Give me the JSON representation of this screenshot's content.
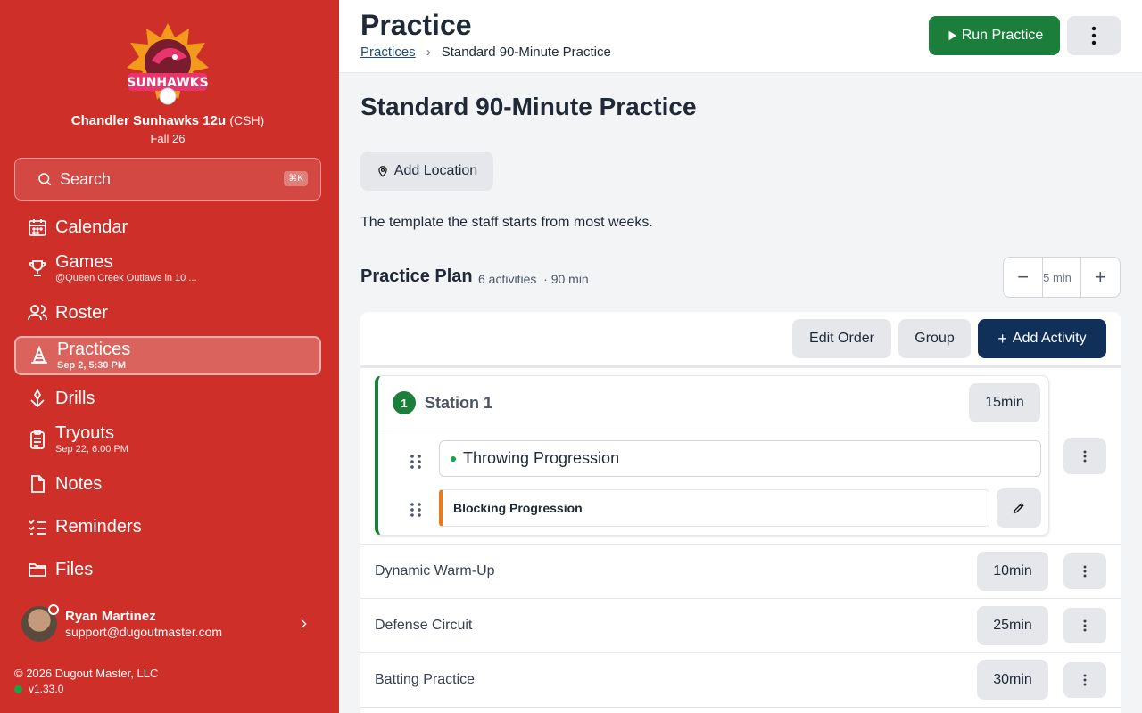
{
  "sidebar": {
    "team_name": "Chandler Sunhawks 12u",
    "team_abbr": "(CSH)",
    "season": "Fall 26",
    "logo_text": "SUNHAWKS",
    "search_placeholder": "Search",
    "search_shortcut": "⌘K",
    "nav": [
      {
        "label": "Calendar",
        "icon": "calendar-icon",
        "sub": ""
      },
      {
        "label": "Games",
        "icon": "trophy-icon",
        "sub": "@Queen Creek Outlaws in 10 ..."
      },
      {
        "label": "Roster",
        "icon": "users-icon",
        "sub": ""
      },
      {
        "label": "Practices",
        "icon": "cone-icon",
        "sub": "Sep 2, 5:30 PM"
      },
      {
        "label": "Drills",
        "icon": "drill-icon",
        "sub": ""
      },
      {
        "label": "Tryouts",
        "icon": "clipboard-icon",
        "sub": "Sep 22, 6:00 PM"
      },
      {
        "label": "Notes",
        "icon": "note-icon",
        "sub": ""
      },
      {
        "label": "Reminders",
        "icon": "checklist-icon",
        "sub": ""
      },
      {
        "label": "Files",
        "icon": "folder-icon",
        "sub": ""
      }
    ],
    "user": {
      "name": "Ryan Martinez",
      "email": "support@dugoutmaster.com"
    },
    "copyright": "© 2026 Dugout Master, LLC",
    "version": "v1.33.0"
  },
  "header": {
    "title": "Practice",
    "breadcrumb_link": "Practices",
    "breadcrumb_current": "Standard 90-Minute Practice",
    "run_label": "Run Practice"
  },
  "practice": {
    "name": "Standard 90-Minute Practice",
    "add_location": "Add Location",
    "description": "The template the staff starts from most weeks."
  },
  "plan": {
    "title": "Practice Plan",
    "activity_count": "6 activities",
    "total": "· 90 min",
    "stepper_value": "5",
    "stepper_unit": "min",
    "edit_order": "Edit Order",
    "group": "Group",
    "add_activity": "Add Activity",
    "station": {
      "number": "1",
      "name": "Station 1",
      "duration": "15min",
      "activities": [
        "Throwing Progression",
        "Blocking Progression"
      ]
    },
    "rows": [
      {
        "label": "Dynamic Warm-Up",
        "duration": "10min"
      },
      {
        "label": "Defense Circuit",
        "duration": "25min"
      },
      {
        "label": "Batting Practice",
        "duration": "30min"
      }
    ]
  },
  "colors": {
    "sidebar_bg": "#cf2f29",
    "run_green": "#1b7f3b",
    "add_navy": "#10305a",
    "accent_orange": "#ea7a1c"
  }
}
